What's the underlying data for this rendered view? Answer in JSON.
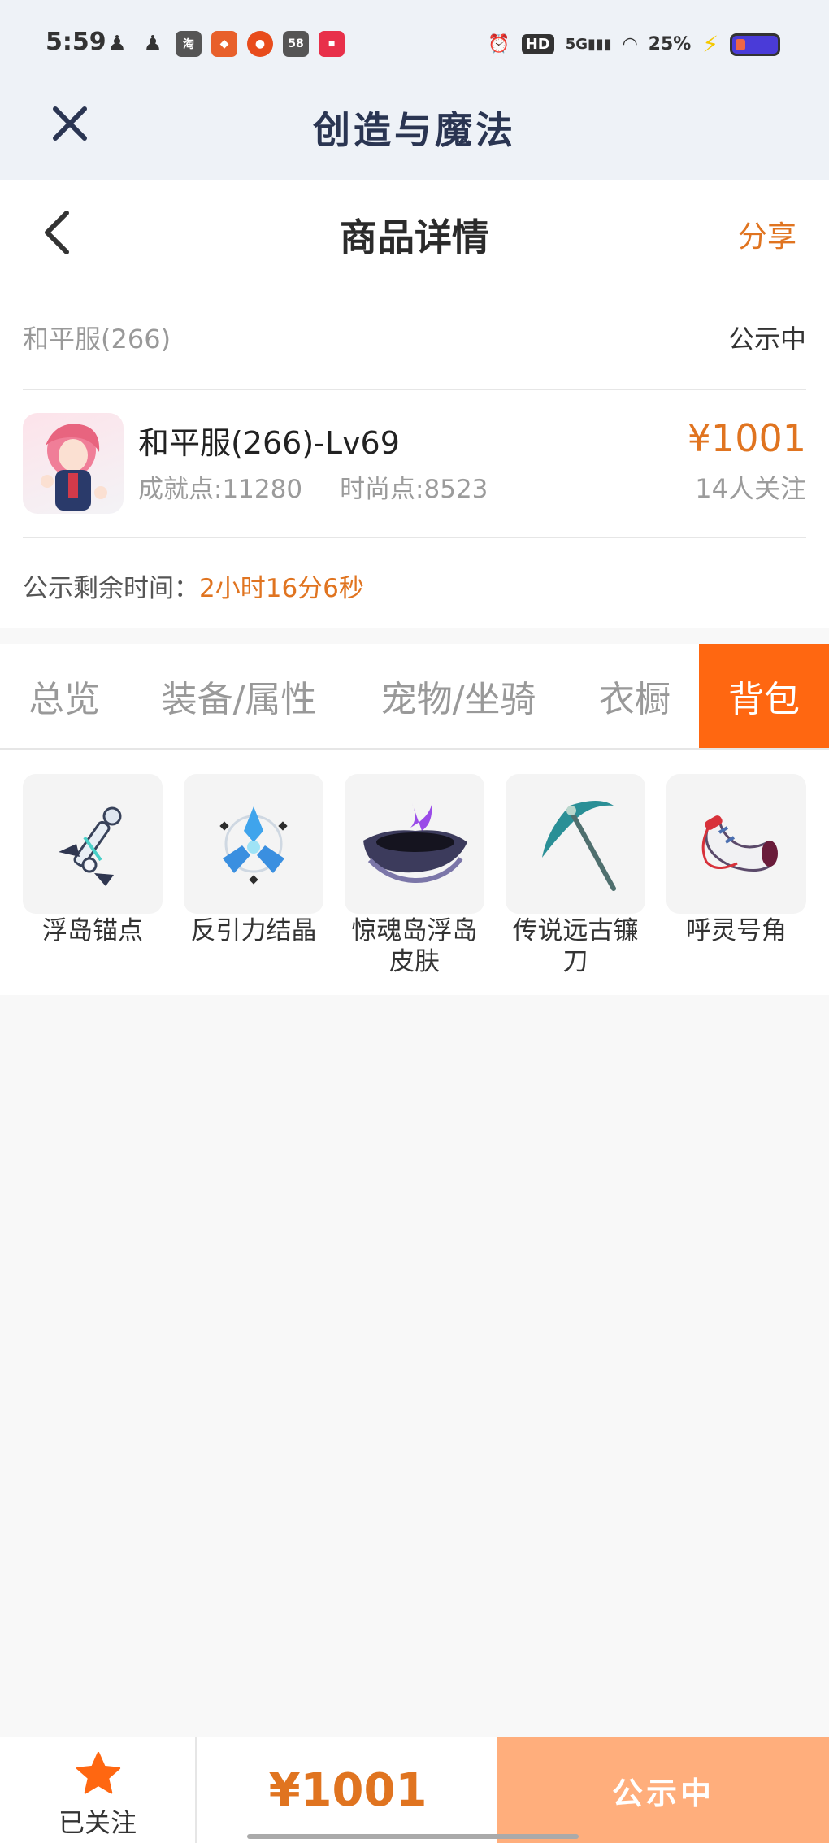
{
  "status_bar": {
    "time": "5:59",
    "battery_text": "25%",
    "network": "5G",
    "hd": "HD"
  },
  "app": {
    "title": "创造与魔法"
  },
  "header": {
    "title": "商品详情",
    "share_label": "分享"
  },
  "listing": {
    "server": "和平服(266)",
    "status": "公示中",
    "character_name": "和平服(266)-Lv69",
    "achievement": "成就点:11280",
    "fashion": "时尚点:8523",
    "price": "¥1001",
    "watchers": "14人关注",
    "countdown_label": "公示剩余时间：",
    "countdown_value": "2小时16分6秒"
  },
  "tabs": [
    {
      "label": "总览",
      "active": false
    },
    {
      "label": "装备/属性",
      "active": false
    },
    {
      "label": "宠物/坐骑",
      "active": false
    },
    {
      "label": "衣橱",
      "active": false
    },
    {
      "label": "背包",
      "active": true
    }
  ],
  "items": [
    {
      "name": "浮岛锚点",
      "icon": "anchor-icon"
    },
    {
      "name": "反引力结晶",
      "icon": "crystal-icon"
    },
    {
      "name": "惊魂岛浮岛皮肤",
      "icon": "island-icon"
    },
    {
      "name": "传说远古镰刀",
      "icon": "scythe-icon"
    },
    {
      "name": "呼灵号角",
      "icon": "horn-icon"
    }
  ],
  "bottom_bar": {
    "follow_label": "已关注",
    "price": "¥1001",
    "status_button": "公示中"
  },
  "colors": {
    "accent": "#e07420",
    "active_tab": "#ff6711",
    "status_button": "#ffae7c"
  }
}
